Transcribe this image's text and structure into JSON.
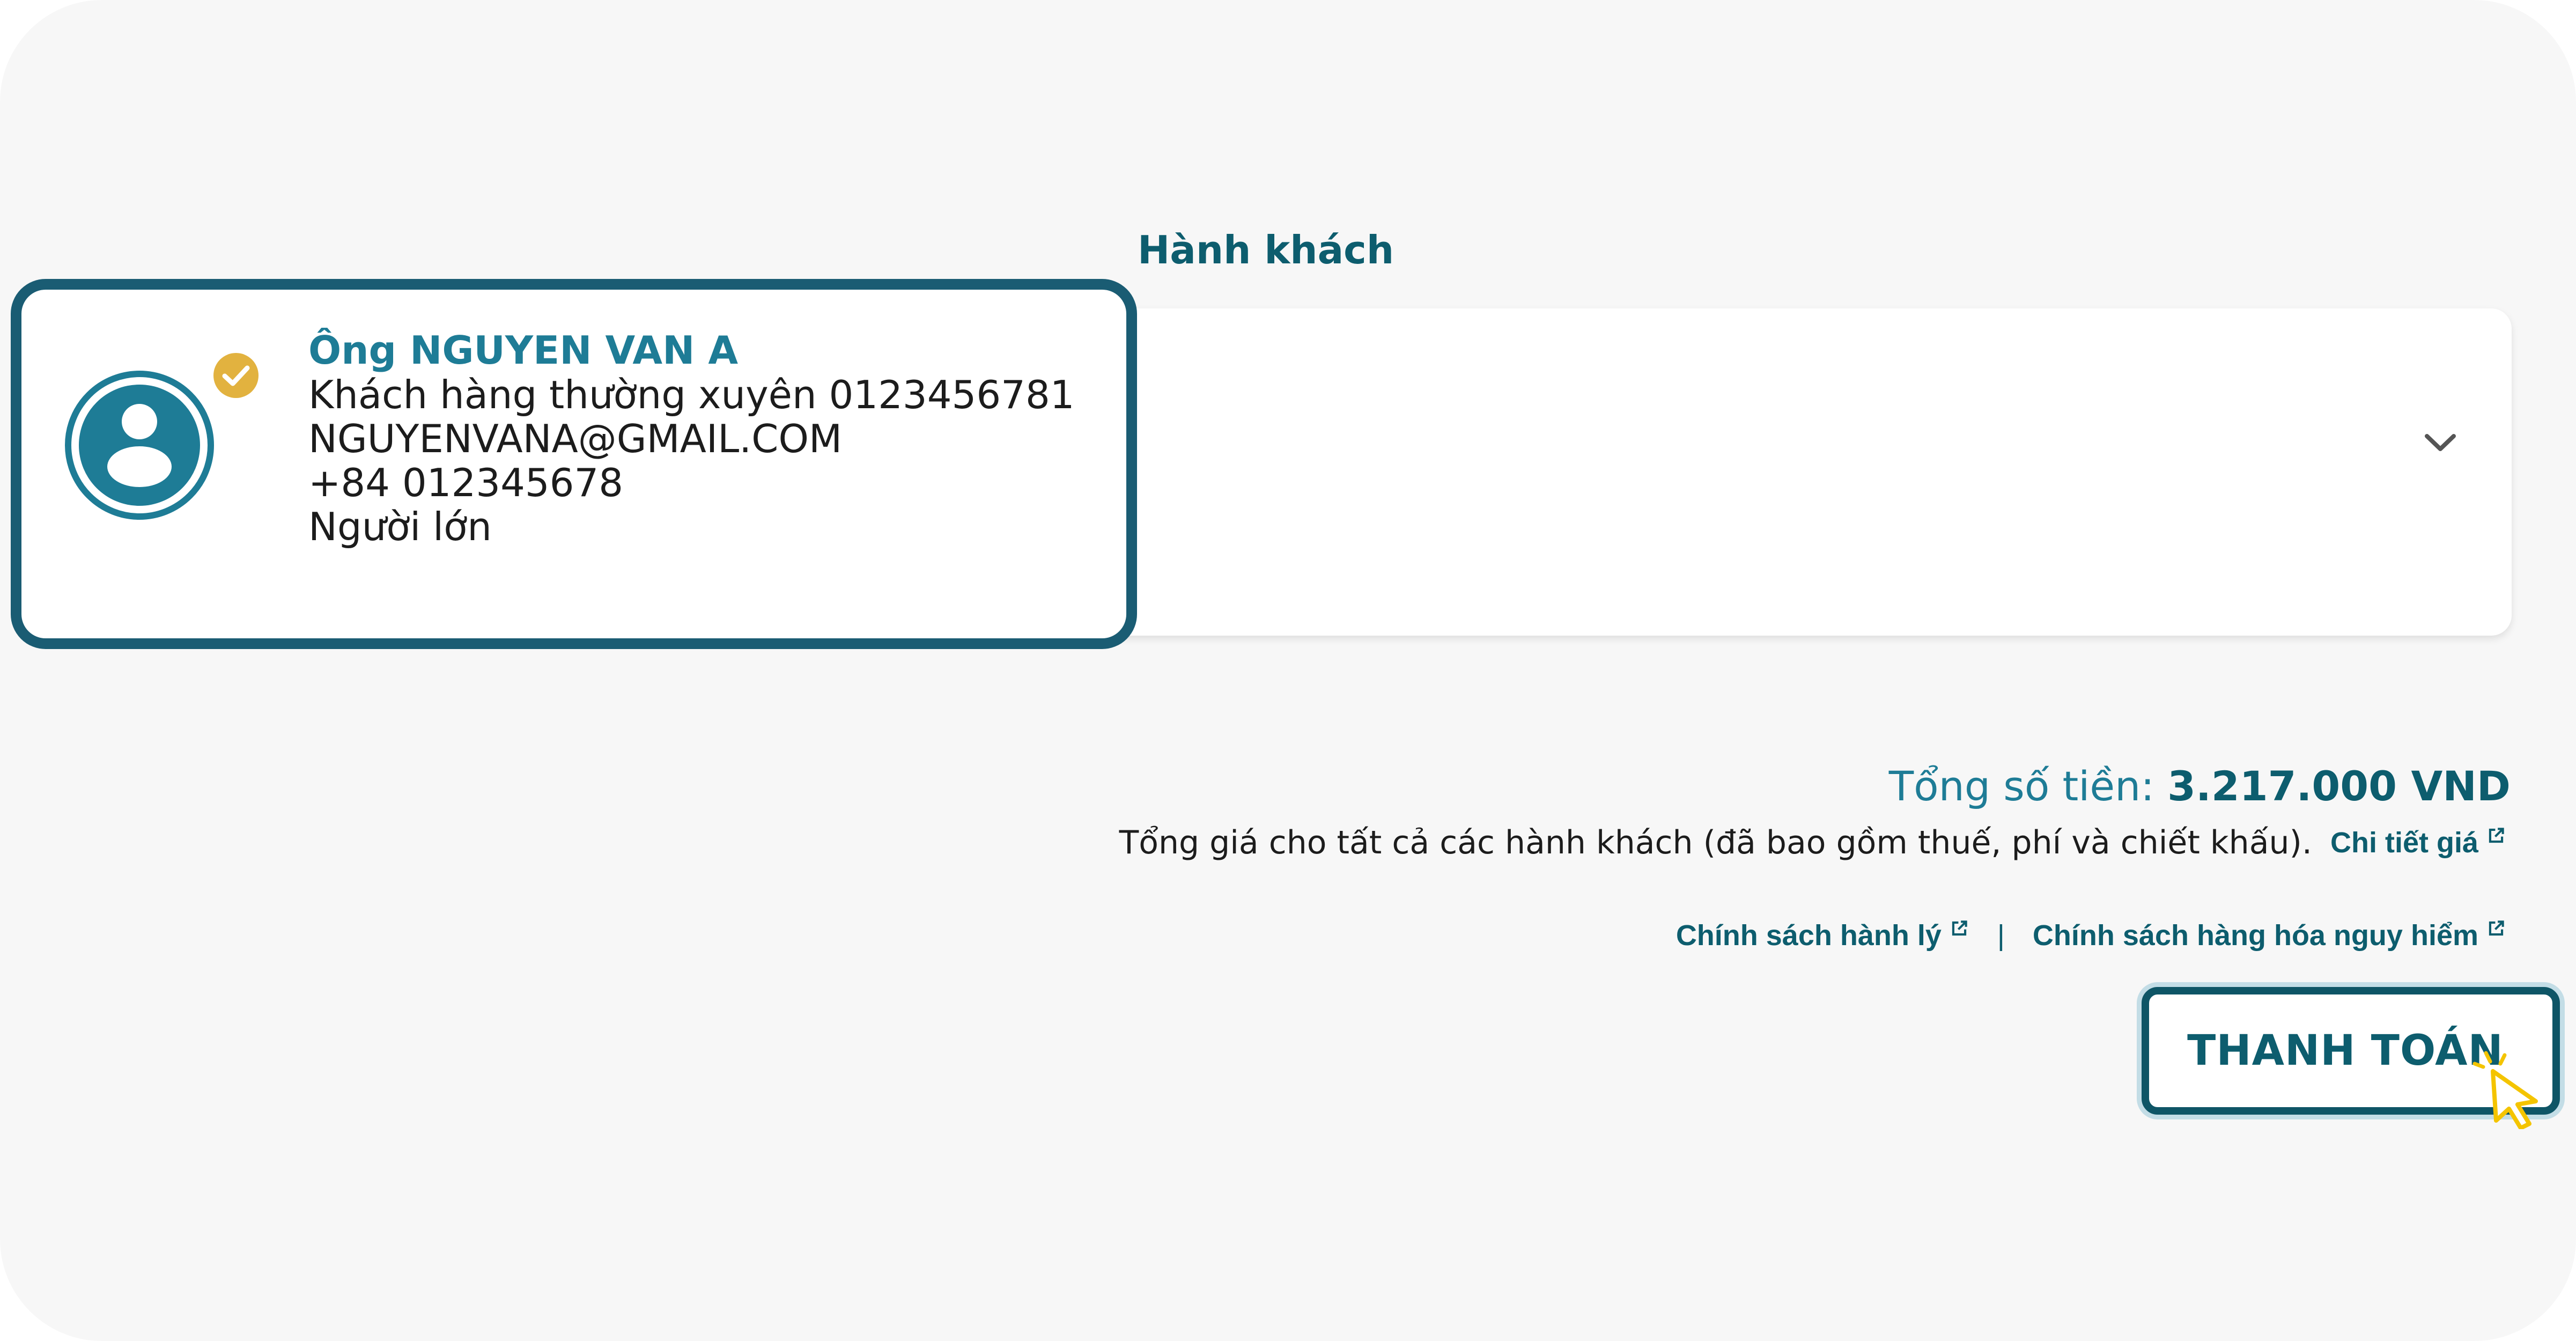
{
  "section": {
    "title": "Hành khách"
  },
  "passenger": {
    "name": "Ông NGUYEN VAN A",
    "member_line": "Khách hàng thường xuyên 0123456781",
    "email": "NGUYENVANA@GMAIL.COM",
    "phone": "+84 012345678",
    "type": "Người lớn",
    "avatar_icon": "user-avatar-icon",
    "badge_icon": "check-circle-icon"
  },
  "panel": {
    "expand_icon": "chevron-down-icon"
  },
  "total": {
    "label": "Tổng số tiền: ",
    "value": "3.217.000 VND",
    "note": "Tổng giá cho tất cả các hành khách (đã bao gồm thuế, phí và chiết khấu).",
    "detail_link": "Chi tiết giá"
  },
  "policies": {
    "baggage_link": "Chính sách hành lý",
    "separator": "|",
    "dangerous_goods_link": "Chính sách hàng hóa nguy hiểm"
  },
  "checkout": {
    "button_label": "THANH TOÁN",
    "cursor_icon": "pointer-cursor-icon"
  },
  "colors": {
    "primary": "#0d5d6e",
    "accent": "#1e7c96",
    "card_border": "#1a5c73",
    "badge": "#e2b23f",
    "cursor": "#f4c400",
    "background": "#f7f7f7"
  }
}
